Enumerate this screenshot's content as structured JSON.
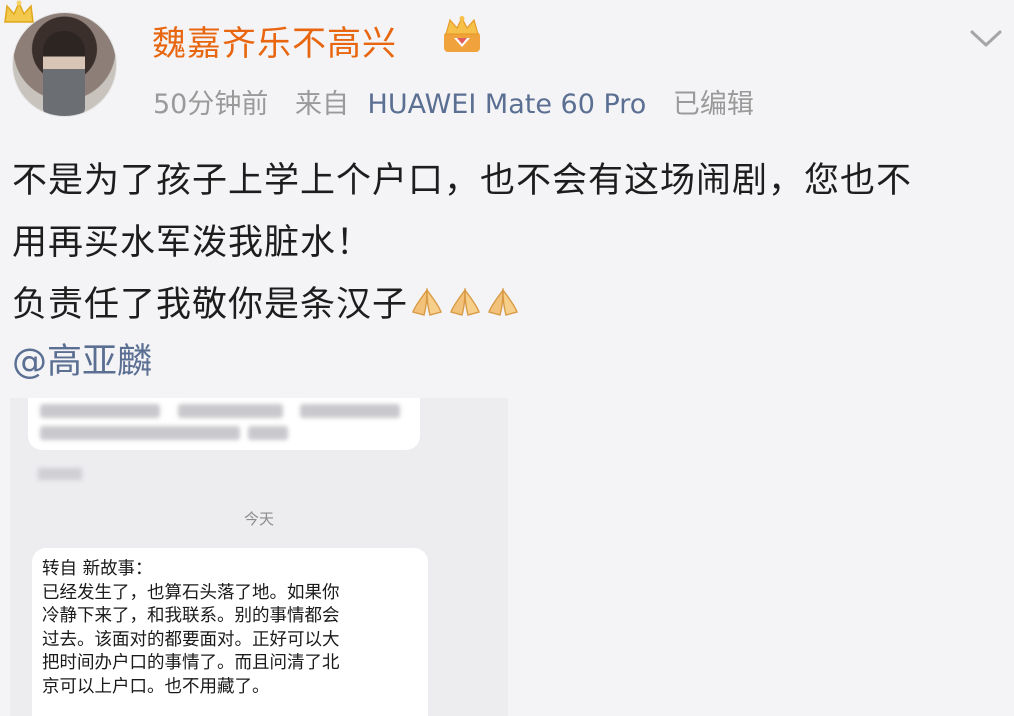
{
  "post": {
    "username": "魏嘉齐乐不高兴",
    "meta": {
      "time": "50分钟前",
      "from_label": "来自",
      "device": "HUAWEI Mate 60 Pro",
      "edited": "已编辑"
    },
    "text_lines": [
      "不是为了孩子上学上个户口，也不会有这场闹剧，您也不",
      "用再买水军泼我脏水！",
      "负责任了我敬你是条汉子"
    ],
    "emoji": [
      "pray-emoji",
      "pray-emoji",
      "pray-emoji"
    ],
    "mention": "@高亚麟"
  },
  "chat_screenshot": {
    "date_divider": "今天",
    "message_lines": [
      "转自 新故事：",
      "已经发生了，也算石头落了地。如果你",
      "冷静下来了，和我联系。别的事情都会",
      "过去。该面对的都要面对。正好可以大",
      "把时间办户口的事情了。而且问清了北",
      "京可以上户口。也不用藏了。"
    ]
  },
  "icons": {
    "badge": "crown-badge-icon",
    "vip": "vip-crown-icon",
    "menu": "chevron-down-icon"
  },
  "colors": {
    "username": "#e8660f",
    "link": "#5b6f93",
    "meta_gray": "#9a9a9a",
    "background": "#f4f4f6"
  }
}
